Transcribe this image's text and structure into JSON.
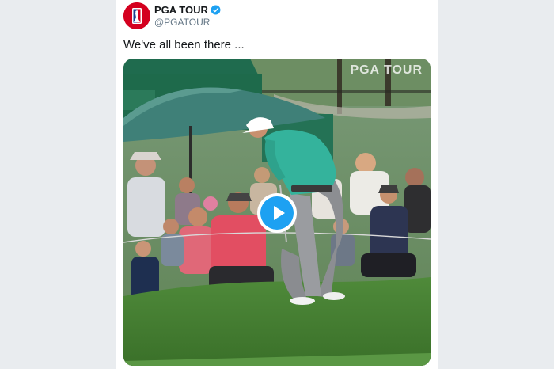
{
  "tweet": {
    "author": {
      "name": "PGA TOUR",
      "handle": "@PGATOUR",
      "verified": true
    },
    "text": "We've all been there ...",
    "media": {
      "type": "video",
      "watermark": "PGA TOUR"
    }
  },
  "colors": {
    "brand_red": "#d4001f",
    "verified_blue": "#1da1f2",
    "handle_gray": "#657786",
    "text_dark": "#14171a"
  },
  "icons": {
    "verified": "verified-badge-icon",
    "play": "play-icon"
  }
}
